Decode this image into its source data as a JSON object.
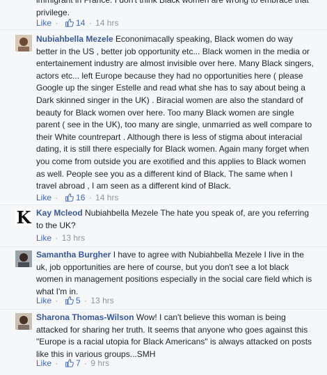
{
  "comments": [
    {
      "text": "immigrant in France. I don't think Black women are wrong to embrace that privilege.",
      "like": "Like",
      "reactions": "14",
      "time": "14 hrs"
    },
    {
      "author": "Nubiahbella Mezele",
      "text": "Econonimacally speaking, Black women do way better in the US , better job opportunity etc... Black women in the media or entertainement industry are almost invisible over here. Many Black singers, actors etc... left Europe because they had no opportunities here ( please Google up the singer Estelle and read what she has to say about being a Dark skinned singer in the UK) . Biracial women are also the standard of beauty for Black women over here. Too many Black women are single parent ( see in the UK), too many are single, unmarried as well compare to their White countrepart . Although there is less of stigma about interacial dating, it is still there especially for Black women. Again many forget when you come from outside you are exotified and this applies to Black women as well. People see you as a different kind of Black. The same when I travel abroad , I am seen as a different kind of Black.",
      "like": "Like",
      "reactions": "16",
      "time": "14 hrs"
    },
    {
      "author": "Kay Mcleod",
      "avatar_letter": "K",
      "text": "Nubiahbella Mezele The hate you speak of, are you referring to the UK?",
      "like": "Like",
      "time": "13 hrs"
    },
    {
      "author": "Samantha Burgher",
      "text": "I have to agree with Nubiahbella Mezele I live in the uk, job opportunities are here of course, but you don't see a lot black women in management positions especially in the social care field which is what I'm in.",
      "like": "Like",
      "reactions": "5",
      "time": "13 hrs"
    },
    {
      "author": "Sharona Thomas-Wilson",
      "text": "Wow! I can't believe this woman is being attacked for sharing her truth. It seems that anyone who goes against this \"Europe is a racial utopia for Black Americans\" is always attacked on posts like this in various groups...SMH",
      "like": "Like",
      "reactions": "7",
      "time": "9 hrs"
    }
  ],
  "colors": {
    "link": "#365899",
    "action": "#4267b2",
    "meta": "#90949c",
    "bg": "#f6f7f9"
  },
  "icons": {
    "reaction": "thumbs-up-icon"
  }
}
